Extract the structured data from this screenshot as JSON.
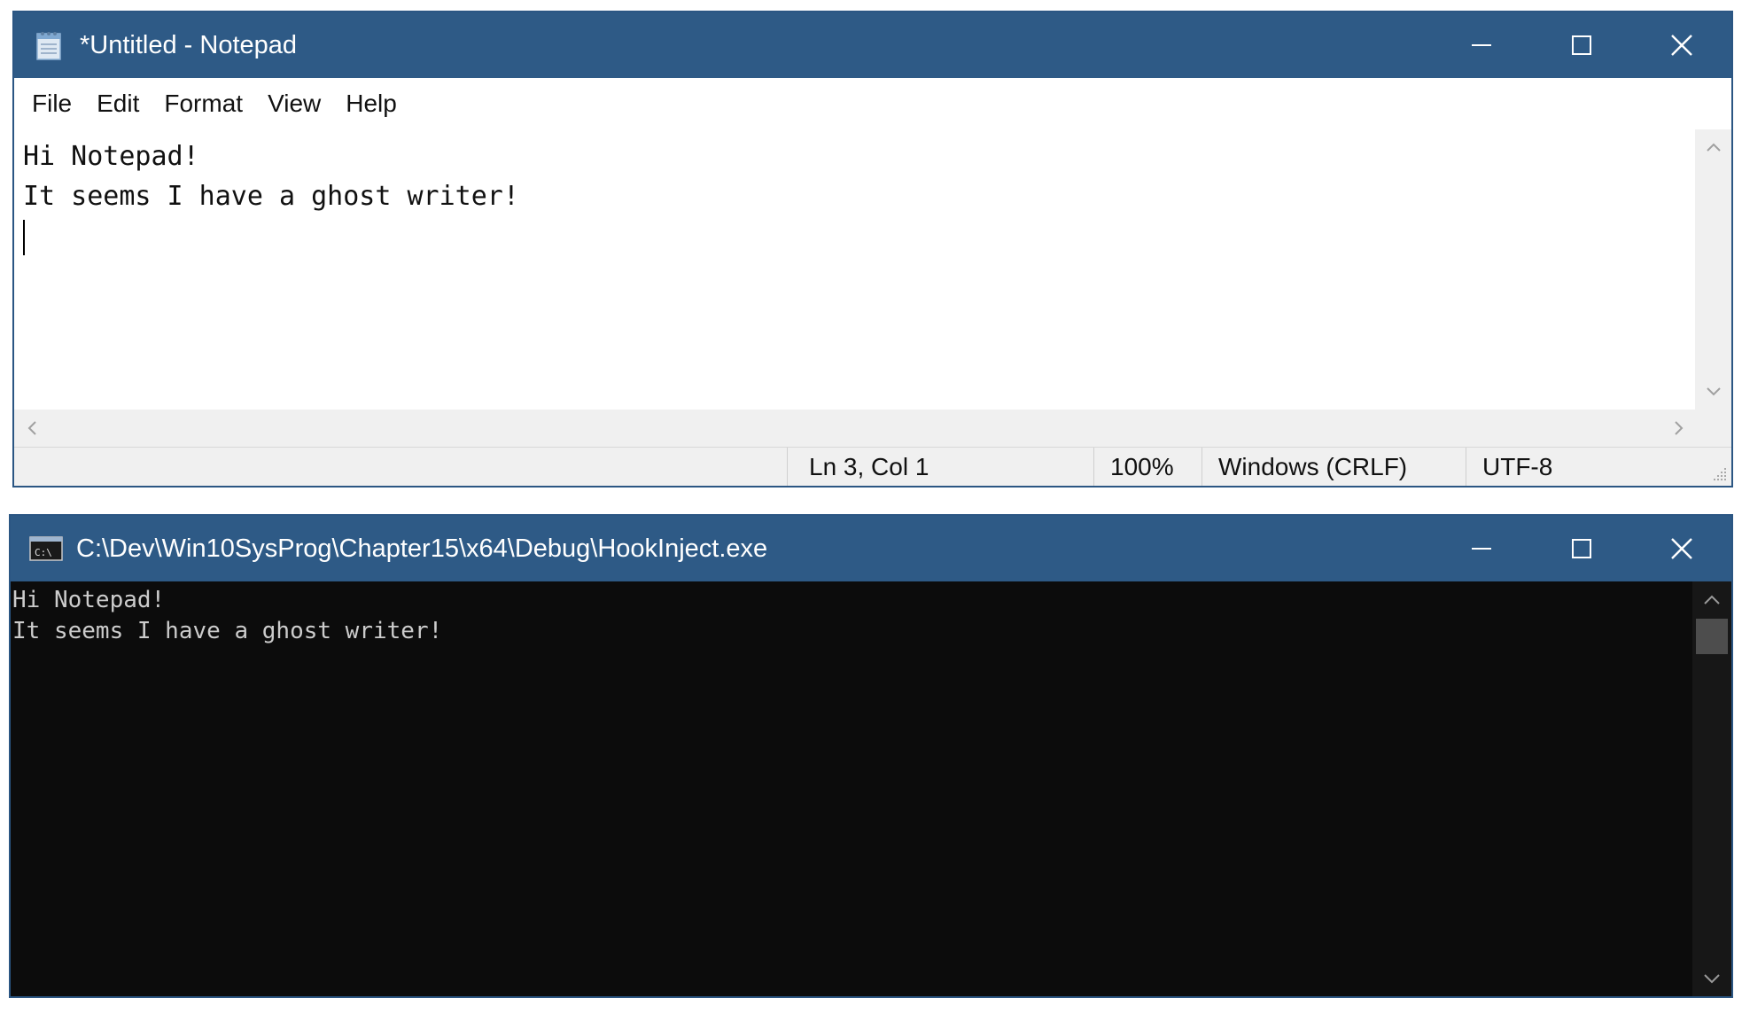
{
  "notepad": {
    "title": "*Untitled - Notepad",
    "menu": [
      "File",
      "Edit",
      "Format",
      "View",
      "Help"
    ],
    "lines": [
      "Hi Notepad!",
      "It seems I have a ghost writer!"
    ],
    "status": {
      "position": "Ln 3, Col 1",
      "zoom": "100%",
      "line_ending": "Windows (CRLF)",
      "encoding": "UTF-8"
    }
  },
  "console": {
    "title": "C:\\Dev\\Win10SysProg\\Chapter15\\x64\\Debug\\HookInject.exe",
    "icon_text": "C:\\",
    "lines": [
      "Hi Notepad!",
      "It seems I have a ghost writer!"
    ]
  },
  "icons": {
    "notepad": "notepad-icon",
    "console": "console-icon",
    "minimize": "minimize-icon",
    "maximize": "maximize-icon",
    "close": "close-icon"
  },
  "colors": {
    "titlebar": "#2e5a86",
    "console_bg": "#0c0c0c",
    "console_text": "#cccccc"
  }
}
